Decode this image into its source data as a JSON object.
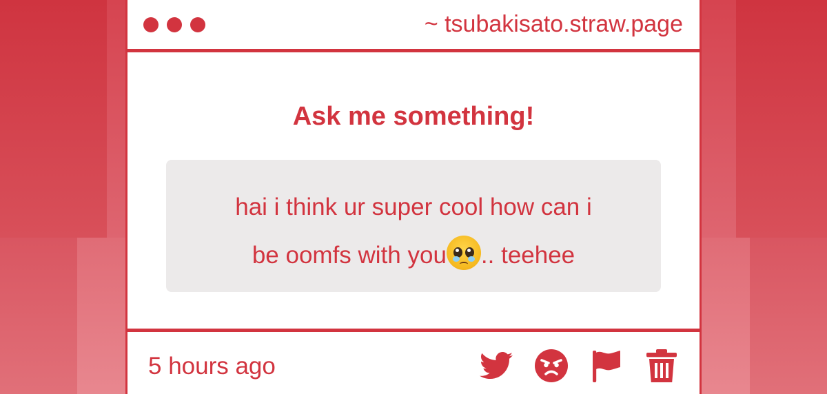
{
  "window": {
    "url": "~ tsubakisato.straw.page"
  },
  "main": {
    "heading": "Ask me something!",
    "message_line1": "hai i think ur super cool how can i",
    "message_line2_before": "be oomfs with you",
    "message_line2_after": ".. teehee",
    "emoji": "pleading-face-emoji"
  },
  "footer": {
    "timestamp": "5 hours ago",
    "actions": [
      "twitter-icon",
      "angry-face-icon",
      "flag-icon",
      "trash-icon"
    ]
  },
  "colors": {
    "accent": "#d2343f",
    "message_bg": "#eceaea",
    "background": "#d8424c"
  }
}
